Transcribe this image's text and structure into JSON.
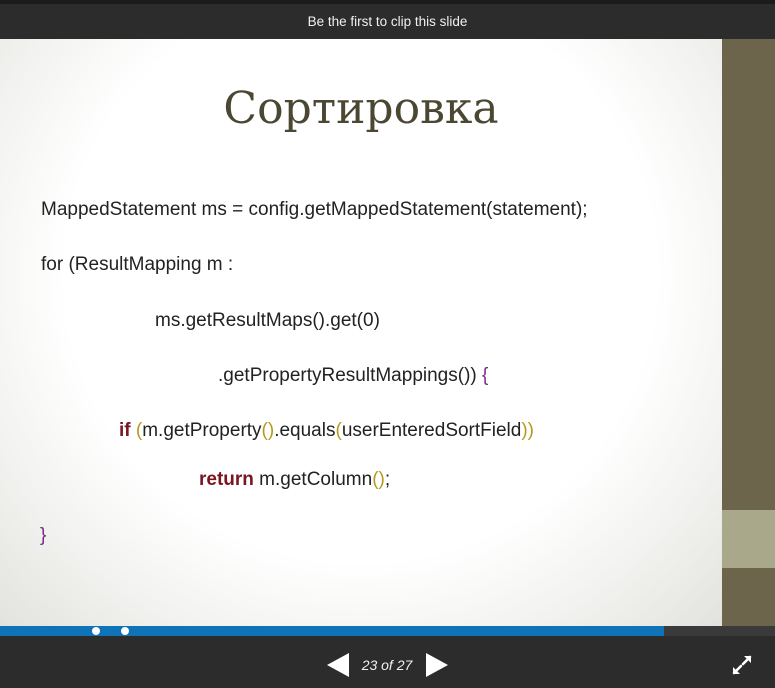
{
  "header": {
    "clip_label": "Be the first to clip this slide"
  },
  "slide": {
    "title": "Сортировка",
    "code": {
      "line1": "MappedStatement ms = config.getMappedStatement(statement);",
      "line2": "for (ResultMapping m :",
      "line3": "ms.getResultMaps().get(0)",
      "line4_text": ".getPropertyResultMappings())",
      "line4_brace": " {",
      "line5_kw": "if",
      "line5_p1": " (",
      "line5_a": "m.getProperty",
      "line5_p2": "()",
      "line5_b": ".equals",
      "line5_p3": "(",
      "line5_c": "userEnteredSortField",
      "line5_p4": "))",
      "line6_kw": "return",
      "line6_text": " m.getColumn",
      "line6_p": "()",
      "line6_semi": ";",
      "line7": "}"
    }
  },
  "player": {
    "progress_fraction": 0.857,
    "page_counter": "23 of 27",
    "current_page": 23,
    "total_pages": 27,
    "icons": {
      "prev": "triangle-left-icon",
      "next": "triangle-right-icon",
      "fullscreen": "expand-arrows-icon"
    }
  },
  "colors": {
    "bars": "#2c2c2c",
    "progress": "#0f73b8",
    "title": "#4b4733",
    "keyword": "#7a1522",
    "brace": "#7b2a8a",
    "paren": "#b59a1a",
    "side_strip": "#6d654b",
    "side_accent": "#a9a88a"
  }
}
